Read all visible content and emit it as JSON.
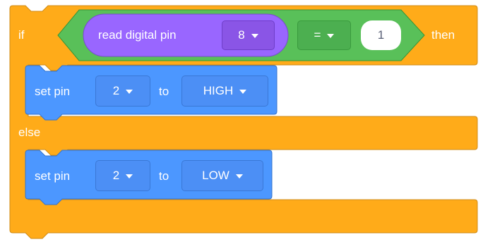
{
  "if_block": {
    "if_label": "if",
    "then_label": "then",
    "else_label": "else"
  },
  "condition": {
    "reporter_label": "read digital pin",
    "pin_value": "8",
    "operator": "=",
    "compare_value": "1"
  },
  "then_stack": {
    "label": "set pin",
    "pin": "2",
    "to_label": "to",
    "level": "HIGH"
  },
  "else_stack": {
    "label": "set pin",
    "pin": "2",
    "to_label": "to",
    "level": "LOW"
  },
  "colors": {
    "control": "#ffab19",
    "control_edge": "#cf8b17",
    "operator": "#59c059",
    "operator_edge": "#389438",
    "sensing": "#9966ff",
    "sensing_edge": "#774dcb",
    "motion": "#4c97ff",
    "motion_edge": "#3373cc"
  }
}
